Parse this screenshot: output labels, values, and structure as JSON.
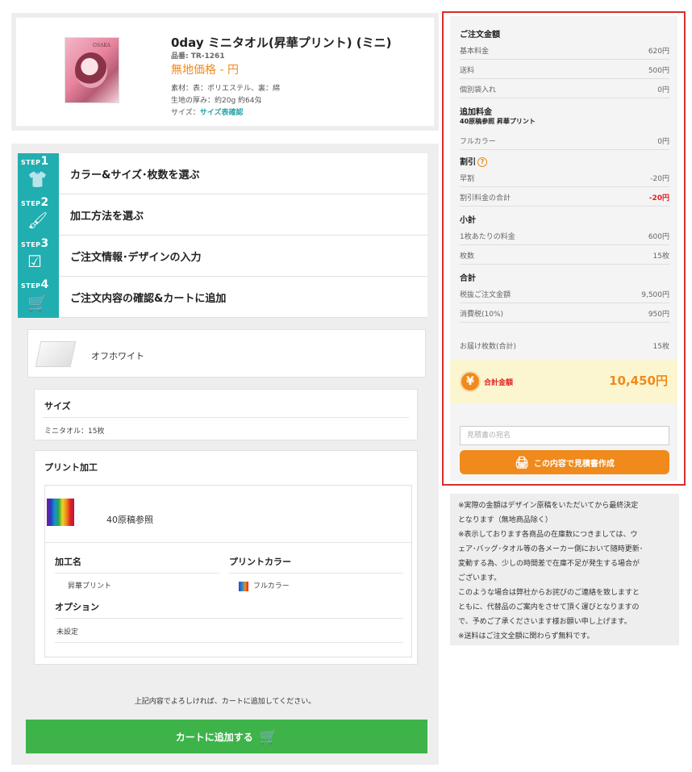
{
  "product": {
    "title": "0day ミニタオル(昇華プリント) (ミニ)",
    "code": "品番: TR-1261",
    "price": "無地価格 - 円",
    "material": "素材：表：ポリエステル、裏：綿",
    "thickness": "生地の厚み：約20g 約64匁",
    "size_label": "サイズ：",
    "size_link": "サイズ表確認",
    "thumb_tag": "OSAKA"
  },
  "steps": [
    {
      "tag": "STEP",
      "num": "1",
      "icon": "👕",
      "label": "カラー&サイズ･枚数を選ぶ"
    },
    {
      "tag": "STEP",
      "num": "2",
      "icon": "🖌",
      "label": "加工方法を選ぶ"
    },
    {
      "tag": "STEP",
      "num": "3",
      "icon": "☑",
      "label": "ご注文情報･デザインの入力"
    },
    {
      "tag": "STEP",
      "num": "4",
      "icon": "🛒",
      "label": "ご注文内容の確認&カートに追加"
    }
  ],
  "color": {
    "name": "オフホワイト"
  },
  "size": {
    "title": "サイズ",
    "value": "ミニタオル：15枚"
  },
  "print": {
    "title": "プリント加工",
    "name": "40原稿参照",
    "process_title": "加工名",
    "process_value": "昇華プリント",
    "color_title": "プリントカラー",
    "color_value": "フルカラー",
    "option_title": "オプション",
    "option_value": "未設定"
  },
  "confirm_text": "上記内容でよろしければ、カートに追加してください。",
  "cart_button": "カートに追加する",
  "summary": {
    "order_total_head": "ご注文金額",
    "base_label": "基本料金",
    "base_value": "620円",
    "shipping_label": "送料",
    "shipping_value": "500円",
    "bag_label": "個別袋入れ",
    "bag_value": "0円",
    "extra_head": "追加料金",
    "extra_sub": "40原稿参照 昇華プリント",
    "fullcolor_label": "フルカラー",
    "fullcolor_value": "0円",
    "discount_head": "割引",
    "early_label": "早割",
    "early_value": "-20円",
    "discount_total_label": "割引料金の合計",
    "discount_total_value": "-20円",
    "subtotal_head": "小計",
    "per_item_label": "1枚あたりの料金",
    "per_item_value": "600円",
    "qty_label": "枚数",
    "qty_value": "15枚",
    "grand_head": "合計",
    "pretax_label": "税抜ご注文金額",
    "pretax_value": "9,500円",
    "tax_label": "消費税(10%)",
    "tax_value": "950円",
    "delivery_label": "お届け枚数(合計)",
    "delivery_value": "15枚",
    "total_label": "合計金額",
    "total_value": "10,450円",
    "estimate_placeholder": "見積書の宛名",
    "estimate_button": "この内容で見積書作成"
  },
  "notes": [
    "※実際の金額はデザイン原稿をいただいてから最終決定",
    "となります（無地商品除く）",
    "※表示しております各商品の在庫数につきましては、ウ",
    "ェア･バッグ･タオル等の各メーカー側において随時更新･",
    "変動する為、少しの時間差で在庫不足が発生する場合が",
    "ございます。",
    "このような場合は弊社からお詫びのご連絡を致しますと",
    "ともに、代替品のご案内をさせて頂く運びとなりますの",
    "で、予めご了承くださいます様お願い申し上げます。",
    "※送料はご注文全額に関わらず無料です。"
  ]
}
